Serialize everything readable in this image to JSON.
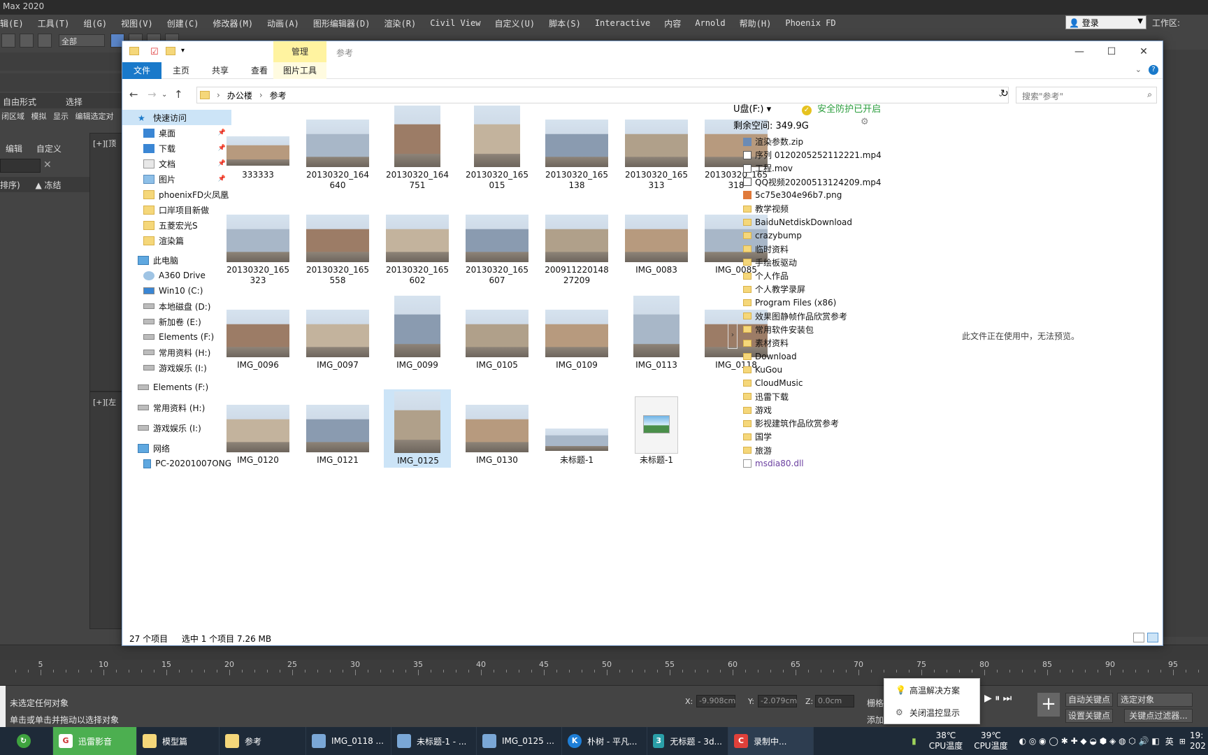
{
  "max": {
    "title": "Max 2020",
    "menu": [
      "编辑(E)",
      "工具(T)",
      "组(G)",
      "视图(V)",
      "创建(C)",
      "修改器(M)",
      "动画(A)",
      "图形编辑器(D)",
      "渲染(R)",
      "Civil View",
      "自定义(U)",
      "脚本(S)",
      "Interactive",
      "内容",
      "Arnold",
      "帮助(H)",
      "Phoenix FD"
    ],
    "login": "登录",
    "workspace": "工作区:",
    "select_filter": "全部",
    "left_panel": {
      "tab1": "自由形式",
      "tab2": "选择",
      "row2": [
        "闭区域",
        "模拟",
        "显示",
        "编辑选定对"
      ],
      "edit": "编辑",
      "customize": "自定义",
      "sort": "排序)",
      "freeze": "▲ 冻结"
    },
    "viewport_top_label": "[+][顶",
    "viewport_bot_label": "[+][左",
    "timeline_ticks": [
      "5",
      "10",
      "15",
      "20",
      "25",
      "30",
      "35",
      "40",
      "45",
      "50",
      "55",
      "60",
      "65",
      "70",
      "75",
      "80",
      "85",
      "90",
      "95"
    ],
    "status_line1": "未选定任何对象",
    "status_line2": "单击或单击并拖动以选择对象",
    "coord_x_label": "X:",
    "coord_x": "-9.908cm",
    "coord_y_label": "Y:",
    "coord_y": "-2.079cm",
    "coord_z_label": "Z:",
    "coord_z": "0.0cm",
    "grid_label": "栅格",
    "add_label": "添加",
    "auto_key": "自动关键点",
    "set_key": "设置关键点",
    "selected_obj": "选定对象",
    "key_filter": "关键点过滤器..."
  },
  "hot_popup": {
    "item1": "高温解决方案",
    "item2": "关闭温控显示"
  },
  "taskbar": {
    "items": [
      "迅雷影音",
      "模型篇",
      "参考",
      "IMG_0118 ...",
      "未标题-1 - ...",
      "IMG_0125 ...",
      "朴树 - 平凡...",
      "无标题 - 3d...",
      "录制中..."
    ],
    "cpu_temp_1_value": "38℃",
    "cpu_temp_1_label": "CPU温度",
    "cpu_temp_2_value": "39℃",
    "cpu_temp_2_label": "CPU温度",
    "lang": "英",
    "clock_time": "19:",
    "clock_date": "202"
  },
  "explorer": {
    "manage_tab": "管理",
    "title": "参考",
    "ribbon_tabs": [
      "文件",
      "主页",
      "共享",
      "查看",
      "图片工具"
    ],
    "breadcrumb": [
      "办公楼",
      "参考"
    ],
    "search_placeholder": "搜索\"参考\"",
    "nav": {
      "quick_access": "快速访问",
      "quick_items": [
        "桌面",
        "下载",
        "文档",
        "图片",
        "phoenixFD火凤凰",
        "口岸项目新做",
        "五菱宏光S",
        "渲染篇"
      ],
      "this_pc": "此电脑",
      "pc_items": [
        "A360 Drive",
        "Win10 (C:)",
        "本地磁盘 (D:)",
        "新加卷 (E:)",
        "Elements (F:)",
        "常用资料 (H:)",
        "游戏娱乐 (I:)"
      ],
      "drives": [
        "Elements (F:)",
        "常用资料 (H:)",
        "游戏娱乐 (I:)"
      ],
      "network": "网络",
      "network_items": [
        "PC-20201007ONG"
      ]
    },
    "files": [
      "333333",
      "20130320_164640",
      "20130320_164751",
      "20130320_165015",
      "20130320_165138",
      "20130320_165313",
      "20130320_165318",
      "20130320_165323",
      "20130320_165558",
      "20130320_165602",
      "20130320_165607",
      "20091122014827209",
      "IMG_0083",
      "IMG_0085",
      "IMG_0096",
      "IMG_0097",
      "IMG_0099",
      "IMG_0105",
      "IMG_0109",
      "IMG_0113",
      "IMG_0118",
      "IMG_0120",
      "IMG_0121",
      "IMG_0125",
      "IMG_0130",
      "未标题-1",
      "未标题-1"
    ],
    "udisk": {
      "drive": "U盘(F:) ▾",
      "safe": "安全防护已开启",
      "free_space": "剩余空间: 349.9G",
      "items": [
        "渲染参数.zip",
        "序列 0120205252112221.mp4",
        "工程.mov",
        "QQ视频20200513124209.mp4",
        "5c75e304e96b7.png",
        "教学视频",
        "BaiduNetdiskDownload",
        "crazybump",
        "临时资料",
        "手绘板驱动",
        "个人作品",
        "个人教学录屏",
        "Program Files (x86)",
        "效果图静帧作品欣赏参考",
        "常用软件安装包",
        "素材资料",
        "Download",
        "KuGou",
        "CloudMusic",
        "迅雷下载",
        "游戏",
        "影视建筑作品欣赏参考",
        "国学",
        "旅游",
        "msdia80.dll"
      ]
    },
    "preview_msg": "此文件正在使用中，无法预览。",
    "status_count": "27 个项目",
    "status_selected": "选中 1 个项目  7.26 MB"
  }
}
